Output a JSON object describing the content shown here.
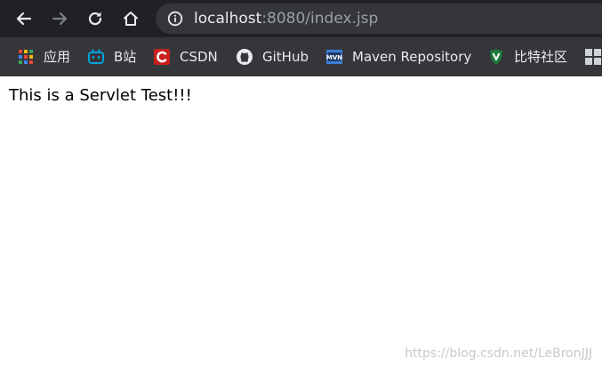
{
  "toolbar": {
    "back_icon": "back-arrow-icon",
    "forward_icon": "forward-arrow-icon",
    "reload_icon": "reload-icon",
    "home_icon": "home-icon",
    "url_host": "localhost",
    "url_rest": ":8080/index.jsp"
  },
  "bookmarks": {
    "items": [
      {
        "label": "应用",
        "icon": "apps-grid-icon"
      },
      {
        "label": "B站",
        "icon": "bilibili-icon"
      },
      {
        "label": "CSDN",
        "icon": "csdn-icon"
      },
      {
        "label": "GitHub",
        "icon": "github-icon"
      },
      {
        "label": "Maven Repository",
        "icon": "maven-icon"
      },
      {
        "label": "比特社区",
        "icon": "bit-shield-icon"
      }
    ]
  },
  "page": {
    "text": "This is a Servlet Test!!!"
  },
  "watermark": {
    "text": "https://blog.csdn.net/LeBronJJJ"
  },
  "colors": {
    "toolbar_bg": "#202124",
    "bookmarks_bg": "#35363a",
    "omnibox_bg": "#35363a",
    "text_light": "#e8eaed",
    "text_dim": "#9aa0a6",
    "csdn_red": "#c9211e",
    "bilibili_blue": "#00a1d6",
    "bit_green": "#1e7b3c"
  }
}
